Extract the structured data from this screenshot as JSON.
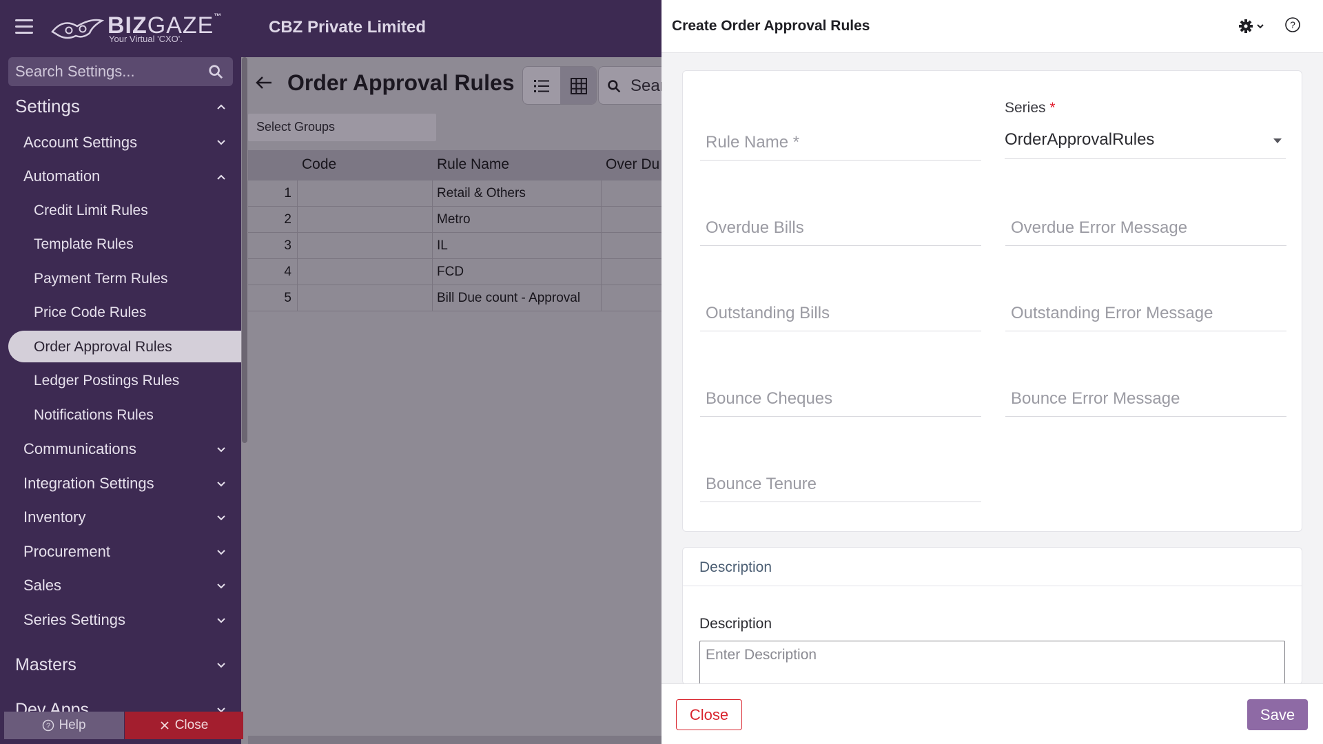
{
  "header": {
    "logo_text": "BIZ",
    "logo_text2": "GAZE",
    "logo_tm": "™",
    "logo_tagline": "Your Virtual 'CXO'.",
    "company": "CBZ Private Limited"
  },
  "sidebar": {
    "search_placeholder": "Search Settings...",
    "settings": "Settings",
    "account_settings": "Account Settings",
    "automation": "Automation",
    "automation_items": [
      "Credit Limit Rules",
      "Template Rules",
      "Payment Term Rules",
      "Price Code Rules",
      "Order Approval Rules",
      "Ledger Postings Rules",
      "Notifications Rules"
    ],
    "groups": [
      "Communications",
      "Integration Settings",
      "Inventory",
      "Procurement",
      "Sales",
      "Series Settings"
    ],
    "masters": "Masters",
    "dev_apps": "Dev Apps",
    "help": "Help",
    "close": "Close"
  },
  "main": {
    "title": "Order Approval Rules",
    "search_text": "Sear",
    "select_groups": "Select Groups",
    "columns": [
      "Code",
      "Rule Name",
      "Over Du"
    ],
    "rows": [
      {
        "index": "1",
        "code": "",
        "rule_name": "Retail & Others"
      },
      {
        "index": "2",
        "code": "",
        "rule_name": "Metro"
      },
      {
        "index": "3",
        "code": "",
        "rule_name": "IL"
      },
      {
        "index": "4",
        "code": "",
        "rule_name": "FCD"
      },
      {
        "index": "5",
        "code": "",
        "rule_name": "Bill Due count - Approval"
      }
    ]
  },
  "drawer": {
    "title": "Create Order Approval Rules",
    "rule_name_placeholder": "Rule Name *",
    "series_label": "Series",
    "series_required": "*",
    "series_value": "OrderApprovalRules",
    "overdue_bills_placeholder": "Overdue Bills",
    "overdue_error_placeholder": "Overdue Error Message",
    "outstanding_bills_placeholder": "Outstanding Bills",
    "outstanding_error_placeholder": "Outstanding Error Message",
    "bounce_cheques_placeholder": "Bounce Cheques",
    "bounce_error_placeholder": "Bounce Error Message",
    "bounce_tenure_placeholder": "Bounce Tenure",
    "description_section": "Description",
    "description_label": "Description",
    "description_placeholder": "Enter Description",
    "close_button": "Close",
    "save_button": "Save"
  },
  "colors": {
    "sidebar_bg": "#3d2a52",
    "accent": "#8e6aa5",
    "danger": "#d9262f"
  }
}
